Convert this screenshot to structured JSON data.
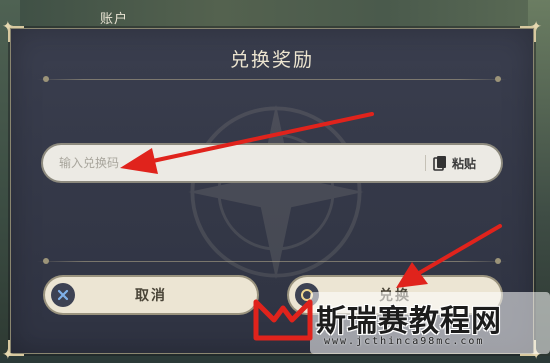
{
  "background": {
    "header_label": "账户"
  },
  "dialog": {
    "title": "兑换奖励",
    "input": {
      "placeholder": "输入兑换码",
      "value": ""
    },
    "paste_label": "粘贴",
    "cancel_label": "取消",
    "confirm_label": "兑换",
    "icons": {
      "paste": "clipboard-icon",
      "cancel": "close-icon",
      "confirm": "confirm-circle-icon"
    }
  },
  "annotations": {
    "arrow_color": "#e0231c"
  },
  "watermark": {
    "text": "斯瑞赛教程网",
    "url": "www.jcthinca98mc.com",
    "logo_color": "#e0231c"
  }
}
